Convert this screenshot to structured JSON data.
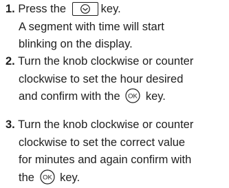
{
  "steps": [
    {
      "number": "1.",
      "line1_pre": "Press the",
      "line1_post": "key.",
      "cont_lines": [
        "A segment with time will start",
        "blinking on the display."
      ]
    },
    {
      "number": "2.",
      "line1": "Turn the knob clockwise or counter",
      "cont_lines": [
        "clockwise to set the hour desired"
      ],
      "last_pre": "and confirm with the",
      "last_post": "key."
    },
    {
      "number": "3.",
      "line1": "Turn the knob clockwise or counter",
      "cont_lines": [
        "clockwise to set the correct value",
        "for minutes and again confirm with"
      ],
      "last_pre": "the",
      "last_post": "key."
    }
  ],
  "icons": {
    "clock_key": "clock-key-icon",
    "ok_key": "ok-key-icon",
    "ok_label": "OK"
  }
}
